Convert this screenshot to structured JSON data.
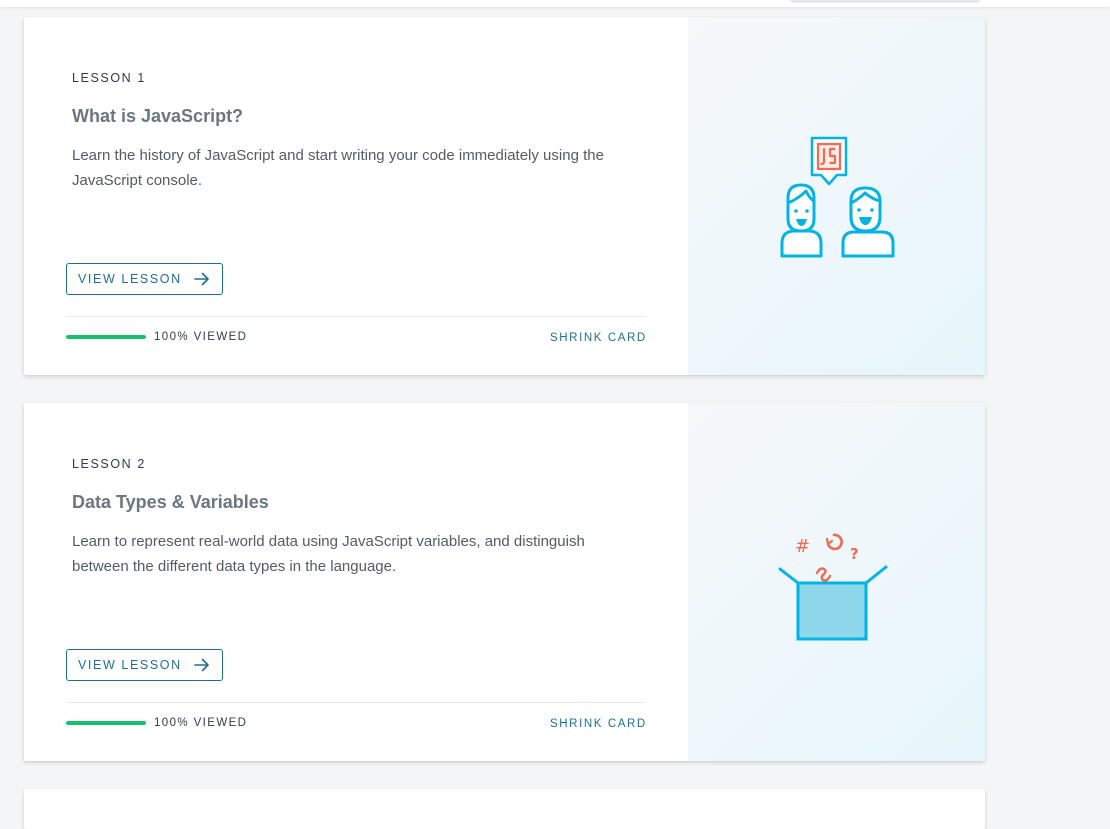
{
  "lessons": [
    {
      "overline": "LESSON 1",
      "title": "What is JavaScript?",
      "description": "Learn the history of JavaScript and start writing your code immediately using the JavaScript console.",
      "view_label": "VIEW LESSON",
      "progress_text": "100% VIEWED",
      "progress_fraction": 1.0,
      "shrink_label": "SHRINK CARD",
      "illustration_icon": "people-talking-js-icon"
    },
    {
      "overline": "LESSON 2",
      "title": "Data Types & Variables",
      "description": "Learn to represent real-world data using JavaScript variables, and distinguish between the different data types in the language.",
      "view_label": "VIEW LESSON",
      "progress_text": "100% VIEWED",
      "progress_fraction": 1.0,
      "shrink_label": "SHRINK CARD",
      "illustration_icon": "open-box-symbols-icon"
    }
  ],
  "colors": {
    "accent": "#1f6f8b",
    "progress": "#15c26b",
    "illustration_blue": "#02b3e4",
    "illustration_orange": "#f26a4f"
  }
}
